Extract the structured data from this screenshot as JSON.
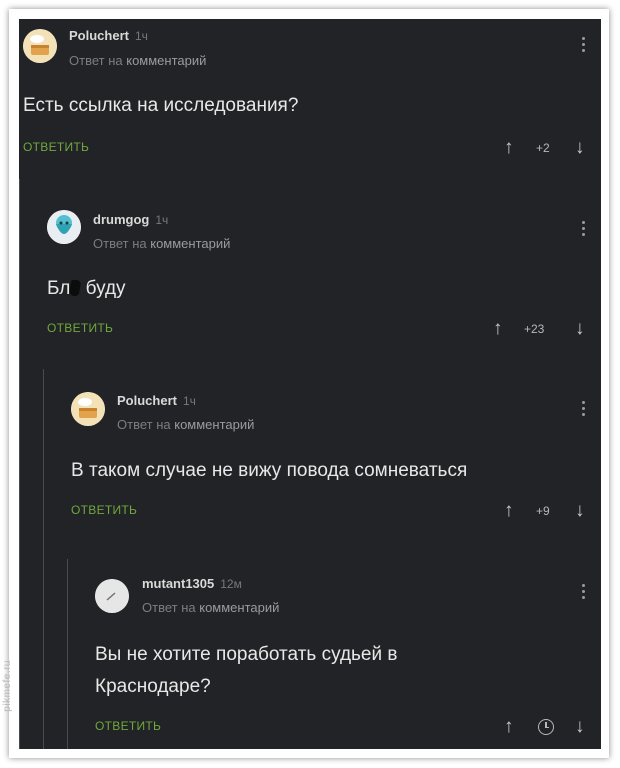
{
  "watermark": "pikmefe.ru",
  "comments": [
    {
      "author": "Poluchert",
      "time": "1ч",
      "reply_prefix": "Ответ на",
      "reply_target": "комментарий",
      "text": "Есть ссылка на исследования?",
      "reply_label": "ОТВЕТИТЬ",
      "score": "+2"
    },
    {
      "author": "drumgog",
      "time": "1ч",
      "reply_prefix": "Ответ на",
      "reply_target": "комментарий",
      "text_start": "Бл",
      "text_end": " буду",
      "reply_label": "ОТВЕТИТЬ",
      "score": "+23"
    },
    {
      "author": "Poluchert",
      "time": "1ч",
      "reply_prefix": "Ответ на",
      "reply_target": "комментарий",
      "text": "В таком случае не вижу повода сомневаться",
      "reply_label": "ОТВЕТИТЬ",
      "score": "+9"
    },
    {
      "author": "mutant1305",
      "time": "12м",
      "reply_prefix": "Ответ на",
      "reply_target": "комментарий",
      "text_line1": "Вы не хотите поработать судьей в",
      "text_line2": "Краснодаре?",
      "reply_label": "ОТВЕТИТЬ"
    }
  ],
  "icons": {
    "upvote": "arrow-up-icon",
    "downvote": "arrow-down-icon",
    "menu": "kebab-menu-icon",
    "pending": "clock-icon"
  }
}
